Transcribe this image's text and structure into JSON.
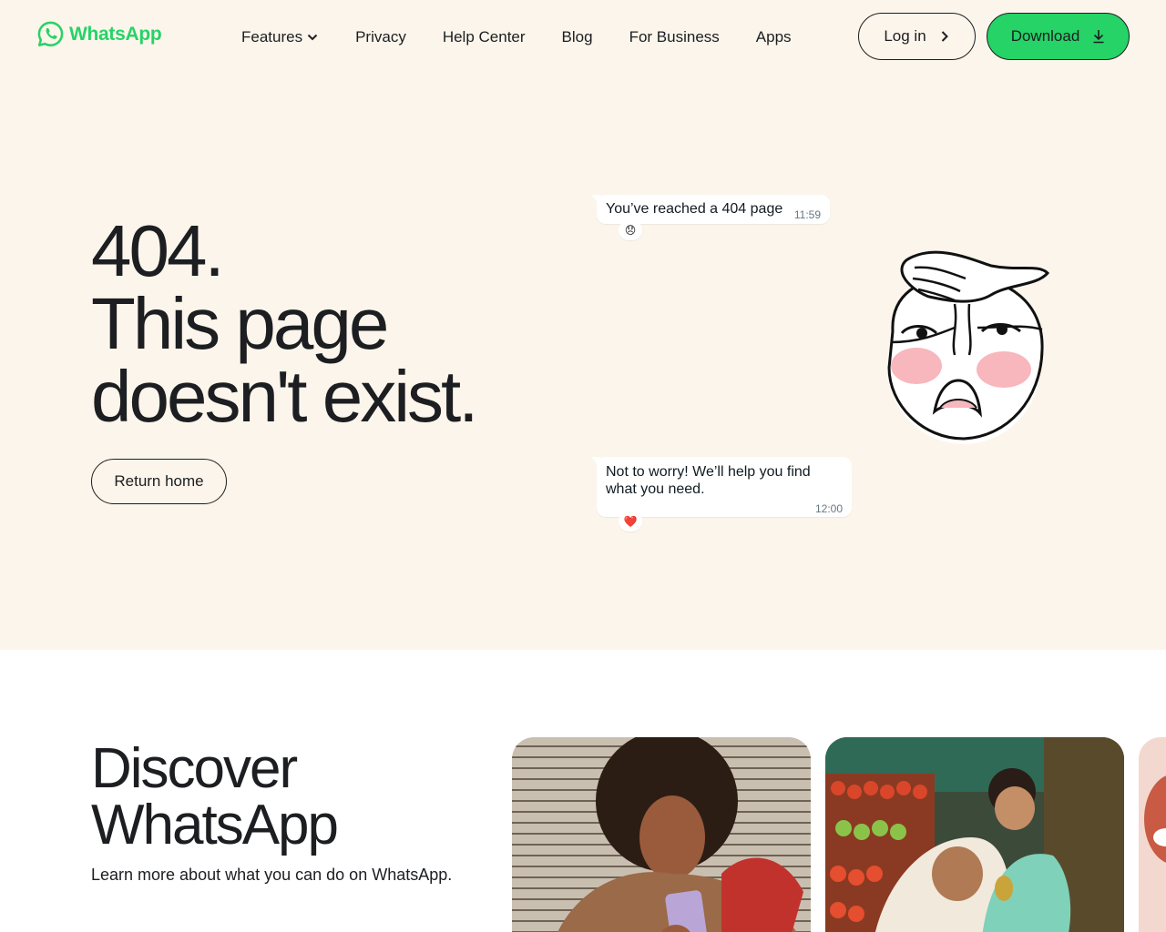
{
  "brand": {
    "name": "WhatsApp",
    "accent": "#25d366",
    "background": "#fcf5eb"
  },
  "nav": {
    "items": [
      {
        "label": "Features",
        "has_dropdown": true
      },
      {
        "label": "Privacy"
      },
      {
        "label": "Help Center"
      },
      {
        "label": "Blog"
      },
      {
        "label": "For Business"
      },
      {
        "label": "Apps"
      }
    ],
    "login_label": "Log in",
    "download_label": "Download"
  },
  "hero": {
    "title_lines": [
      "404.",
      "This page",
      "doesn't exist."
    ],
    "return_label": "Return home"
  },
  "chat": {
    "messages": [
      {
        "text": "You’ve reached a 404 page",
        "time": "11:59",
        "reaction": "😞"
      },
      {
        "text": "Not to worry! We’ll help you find what you need.",
        "time": "12:00",
        "reaction": "❤️"
      }
    ]
  },
  "discover": {
    "title_lines": [
      "Discover",
      "WhatsApp"
    ],
    "subtitle": "Learn more about what you can do on WhatsApp."
  },
  "icons": {
    "logo": "whatsapp-logo-icon",
    "features_dropdown": "chevron-down-icon",
    "login": "chevron-right-icon",
    "download": "download-arrow-icon"
  }
}
